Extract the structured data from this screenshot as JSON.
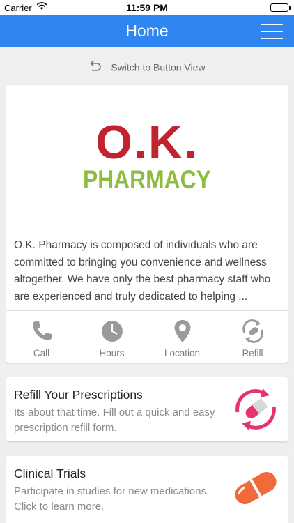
{
  "status_bar": {
    "carrier": "Carrier",
    "time": "11:59 PM"
  },
  "nav": {
    "title": "Home"
  },
  "switch_view": {
    "label": "Switch to Button View"
  },
  "main_card": {
    "logo_line1": "O.K.",
    "logo_line2": "PHARMACY",
    "description": "O.K. Pharmacy is composed of individuals who are committed to bringing you convenience and wellness altogether. We have only the best pharmacy staff who are experienced and truly dedicated to helping ...",
    "actions": [
      {
        "label": "Call",
        "icon": "phone-icon"
      },
      {
        "label": "Hours",
        "icon": "clock-icon"
      },
      {
        "label": "Location",
        "icon": "location-pin-icon"
      },
      {
        "label": "Refill",
        "icon": "refill-icon"
      }
    ]
  },
  "promos": [
    {
      "title": "Refill Your Prescriptions",
      "text": "Its about that time. Fill out a quick and easy prescription refill form.",
      "icon": "pill-refill-icon"
    },
    {
      "title": "Clinical Trials",
      "text": "Participate in studies for new medications. Click to learn more.",
      "icon": "capsule-icon"
    }
  ],
  "colors": {
    "nav": "#2f86f0",
    "logo_red": "#c2242f",
    "logo_green": "#8dbd3e",
    "accent_pink": "#e8336c",
    "accent_orange": "#f26a3a"
  }
}
